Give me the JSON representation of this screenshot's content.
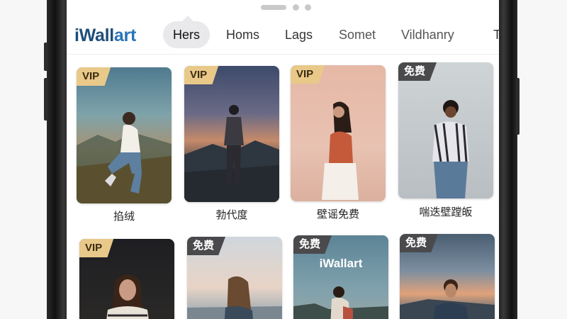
{
  "app": {
    "logo_part1": "iWall",
    "logo_part2": "art"
  },
  "tabs": [
    {
      "label": "Hers",
      "active": true
    },
    {
      "label": "Homs"
    },
    {
      "label": "Lags"
    },
    {
      "label": "Somet"
    },
    {
      "label": "Vildhanry"
    },
    {
      "label": "T"
    }
  ],
  "grid": {
    "row1": [
      {
        "badge": "VIP",
        "caption": "掐绒"
      },
      {
        "badge": "VIP",
        "caption": "勃代度"
      },
      {
        "badge": "VIP",
        "caption": "壁谣免费"
      },
      {
        "badge": "免费",
        "caption": "喘迭壁蹚皈"
      }
    ],
    "row2": [
      {
        "badge": "VIP"
      },
      {
        "badge": "免费"
      },
      {
        "badge": "免费",
        "watermark": "iWallart"
      },
      {
        "badge": "免费"
      }
    ]
  },
  "colors": {
    "vip_badge": "#e9c98a",
    "free_badge": "#4a4a4d",
    "logo": "#1f4e7a"
  }
}
